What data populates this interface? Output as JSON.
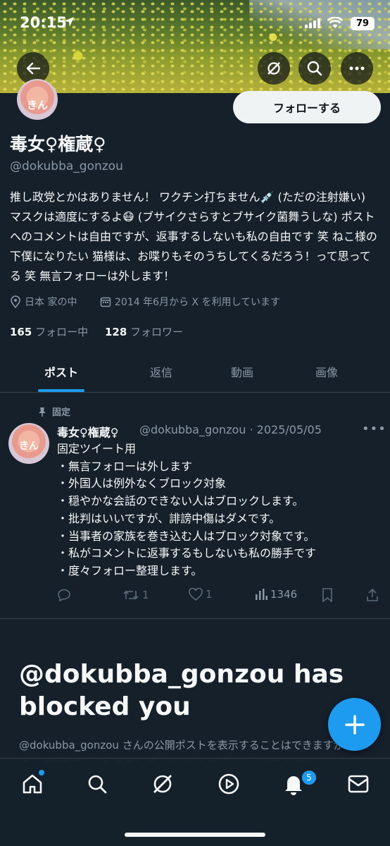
{
  "status_bar": {
    "time": "20:15",
    "battery": "79"
  },
  "profile": {
    "avatar_text": "きん",
    "follow_label": "フォローする",
    "display_name": "毒女♀権蔵♀",
    "handle": "@dokubba_gonzou",
    "bio": "推し政党とかはありません！ ワクチン打ちません💉 (ただの注射嫌い) マスクは適度にするよ😷 (ブサイクさらすとブサイク菌舞うしな) ポストへのコメントは自由ですが、返事するしないも私の自由です 笑 ねこ様の下僕になりたい 猫様は、お喋りもそのうちしてくるだろう！って思ってる 笑 無言フォローは外します！",
    "location": "日本 家の中",
    "joined": "2014 年6月から X を利用しています",
    "following_count": "165",
    "following_label": "フォロー中",
    "followers_count": "128",
    "followers_label": "フォロワー"
  },
  "tabs": [
    {
      "label": "ポスト",
      "active": true
    },
    {
      "label": "返信",
      "active": false
    },
    {
      "label": "動画",
      "active": false
    },
    {
      "label": "画像",
      "active": false
    }
  ],
  "pinned_post": {
    "pinned_label": "固定",
    "author_name": "毒女♀権蔵♀",
    "meta": "@dokubba_gonzou · 2025/05/05",
    "lines": [
      "固定ツイート用",
      "・無言フォローは外します",
      "・外国人は例外なくブロック対象",
      "・穏やかな会話のできない人はブロックします。",
      "・批判はいいですが、誹謗中傷はダメです。",
      "・当事者の家族を巻き込む人はブロック対象です。",
      "・私がコメントに返事するもしないも私の勝手です",
      "・度々フォロー整理します。"
    ],
    "retweets": "1",
    "likes": "1",
    "views": "1346"
  },
  "blocked": {
    "title": "@dokubba_gonzou has blocked you",
    "description": "@dokubba_gonzou さんの公開ポストを表示することはできますが、ブロックされているためエンゲージメントを行うことはできません。"
  },
  "bottom_nav": {
    "notifications_badge": "5"
  },
  "colors": {
    "accent": "#1d9bf0",
    "background": "#15202b",
    "muted": "#8b98a5"
  },
  "icons": [
    "back-arrow-icon",
    "grok-icon",
    "search-icon",
    "more-icon",
    "location-pin-icon",
    "calendar-icon",
    "pin-icon",
    "reply-icon",
    "retweet-icon",
    "like-icon",
    "views-icon",
    "bookmark-icon",
    "share-icon",
    "plus-icon",
    "home-icon",
    "explore-icon",
    "grok-nav-icon",
    "video-icon",
    "bell-icon",
    "mail-icon"
  ]
}
